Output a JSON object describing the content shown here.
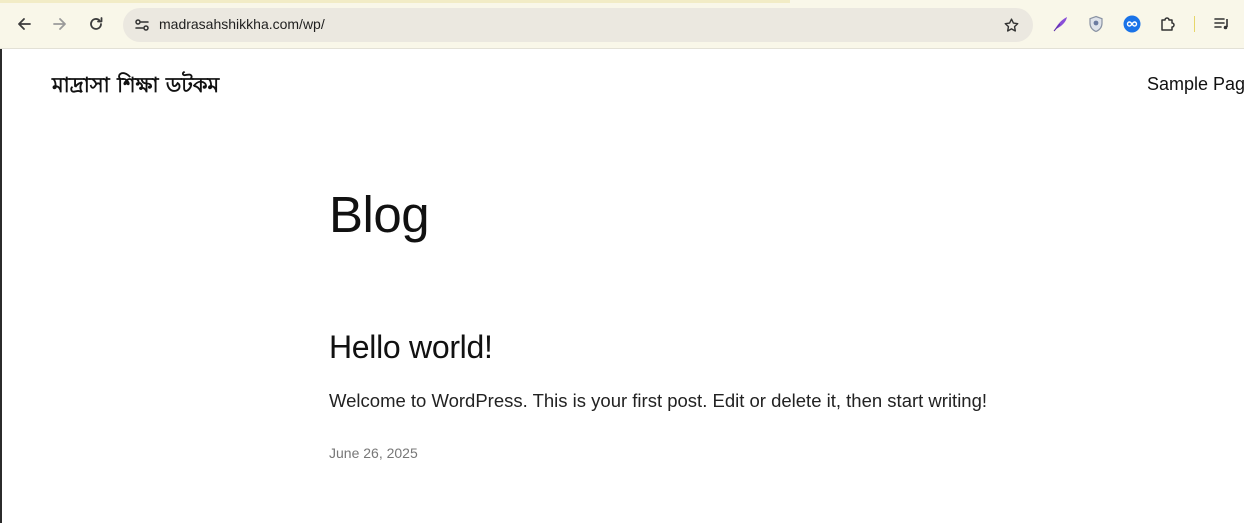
{
  "browser": {
    "url": "madrasahshikkha.com/wp/",
    "icons": {
      "back": "arrow-left-icon",
      "forward": "arrow-right-icon",
      "reload": "reload-icon",
      "site_info": "tune-icon",
      "bookmark": "star-icon",
      "ext1": "feather-extension-icon",
      "ext2": "shield-extension-icon",
      "ext3": "infinity-extension-icon",
      "extensions": "puzzle-icon",
      "reading_list": "queue-music-icon"
    }
  },
  "site": {
    "title": "মাদ্রাসা শিক্ষা ডটকম",
    "nav": {
      "sample_page": "Sample Page"
    }
  },
  "main": {
    "page_title": "Blog",
    "posts": [
      {
        "title": "Hello world!",
        "excerpt": "Welcome to WordPress. This is your first post. Edit or delete it, then start writing!",
        "date": "June 26, 2025"
      }
    ]
  },
  "colors": {
    "toolbar_bg": "#f9f7e9",
    "omnibox_bg": "#ebe8e0",
    "text": "#111111",
    "date_text": "#777777"
  }
}
